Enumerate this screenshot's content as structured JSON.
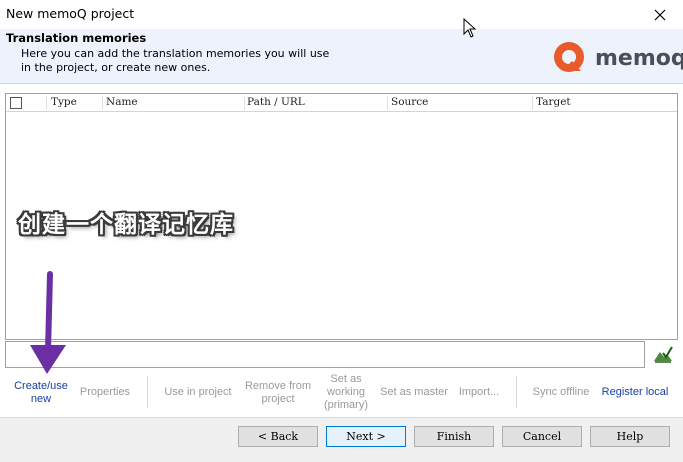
{
  "window": {
    "title": "New memoQ project",
    "close_icon": "close-icon"
  },
  "header": {
    "title": "Translation memories",
    "description": "Here you can add the translation memories you will use\nin the project, or create new ones.",
    "logo_text": "memoq",
    "logo_color": "#e85c2c"
  },
  "table": {
    "columns": [
      "Type",
      "Name",
      "Path / URL",
      "Source",
      "Target"
    ]
  },
  "annotation": {
    "text": "创建一个翻译记忆库",
    "arrow_color": "#6a2fa3"
  },
  "toolbar": {
    "create_new": "Create/use\nnew",
    "properties": "Properties",
    "use_in_project": "Use in project",
    "remove_from_project": "Remove from\nproject",
    "set_as_working": "Set as\nworking\n(primary)",
    "set_as_master": "Set as master",
    "import": "Import...",
    "sync_offline": "Sync offline",
    "register_local": "Register local"
  },
  "footer": {
    "back": "< Back",
    "next": "Next >",
    "finish": "Finish",
    "cancel": "Cancel",
    "help": "Help"
  }
}
